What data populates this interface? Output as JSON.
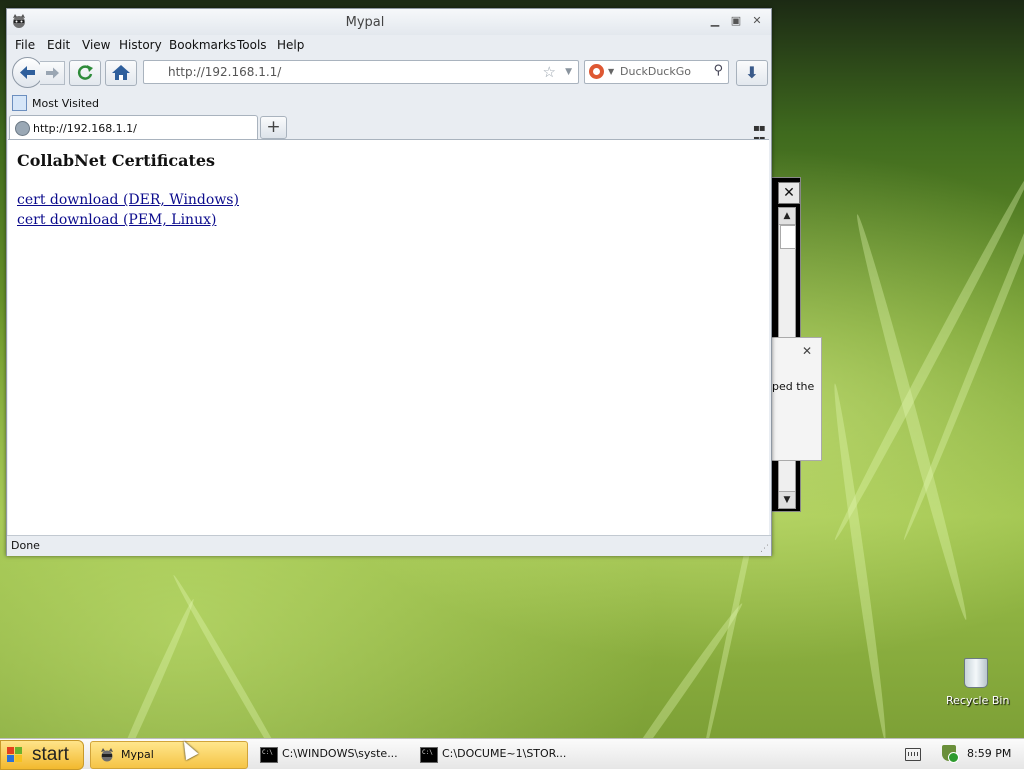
{
  "browser": {
    "title": "Mypal",
    "menu": [
      "File",
      "Edit",
      "View",
      "History",
      "Bookmarks",
      "Tools",
      "Help"
    ],
    "url": "http://192.168.1.1/",
    "search_engine": "DuckDuckGo",
    "bookmarks_toolbar": {
      "most_visited": "Most Visited"
    },
    "tab": {
      "title": "http://192.168.1.1/"
    },
    "status": "Done"
  },
  "page": {
    "heading": "CollabNet Certificates",
    "links": [
      "cert download (DER, Windows)",
      "cert download (PEM, Linux)"
    ]
  },
  "background_dialog": {
    "text_fragment": "ped the"
  },
  "desktop": {
    "recycle_bin_label": "Recycle Bin"
  },
  "taskbar": {
    "start_label": "start",
    "items": [
      "Mypal",
      "C:\\WINDOWS\\syste...",
      "C:\\DOCUME~1\\STOR..."
    ],
    "clock": "8:59 PM"
  },
  "colors": {
    "link": "#0b0b8c",
    "start_button": "#f2b92e",
    "active_task": "#f5c446"
  },
  "icons": [
    "raccoon-app-icon",
    "back-arrow-icon",
    "forward-arrow-icon",
    "reload-icon",
    "home-icon",
    "star-icon",
    "dropdown-icon",
    "duckduckgo-icon",
    "magnifier-icon",
    "download-arrow-icon",
    "globe-icon",
    "plus-icon",
    "all-tabs-icon",
    "windows-flag-icon",
    "console-icon",
    "keyboard-icon",
    "shield-icon",
    "recycle-bin-icon",
    "mouse-cursor-icon"
  ]
}
